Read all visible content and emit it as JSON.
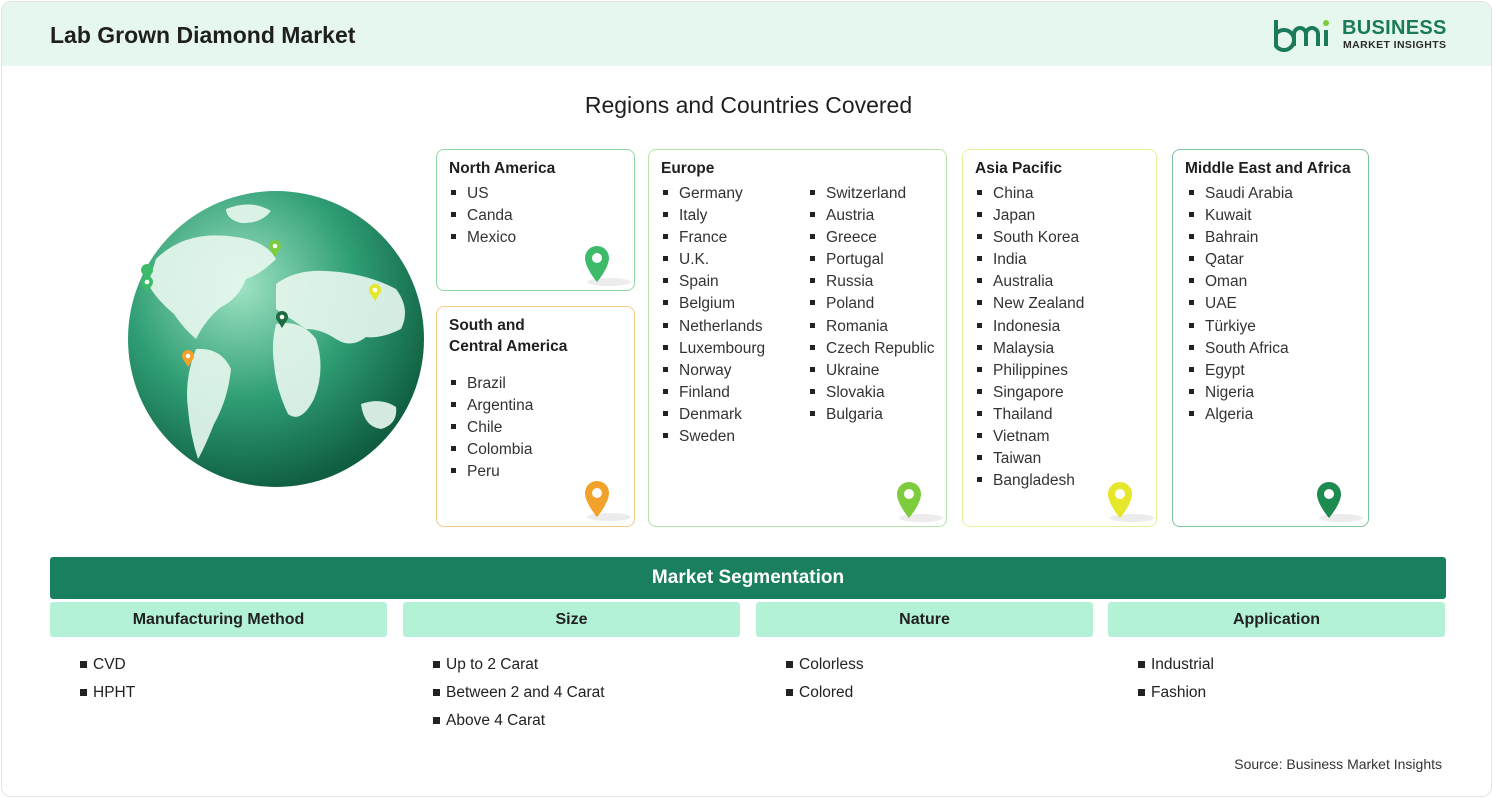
{
  "header": {
    "title": "Lab Grown Diamond Market"
  },
  "logo": {
    "line1": "BUSINESS",
    "line2": "MARKET INSIGHTS",
    "brand_color": "#1a7a5a"
  },
  "subtitle": "Regions and Countries Covered",
  "regions": {
    "north_america": {
      "title": "North America",
      "countries": [
        "US",
        "Canda",
        "Mexico"
      ],
      "pin_color": "#3dbb6a"
    },
    "south_central_america": {
      "title_line1": "South and",
      "title_line2": "Central America",
      "countries": [
        "Brazil",
        "Argentina",
        "Chile",
        "Colombia",
        "Peru"
      ],
      "pin_color": "#f2a12a"
    },
    "europe": {
      "title": "Europe",
      "countries_col1": [
        "Germany",
        "Italy",
        "France",
        "U.K.",
        "Spain",
        "Belgium",
        "Netherlands",
        "Luxembourg",
        "Norway",
        "Finland",
        "Denmark",
        "Sweden"
      ],
      "countries_col2": [
        "Switzerland",
        "Austria",
        "Greece",
        "Portugal",
        "Russia",
        "Poland",
        "Romania",
        "Czech Republic",
        "Ukraine",
        "Slovakia",
        "Bulgaria"
      ],
      "pin_color": "#7dcc3e"
    },
    "asia_pacific": {
      "title": "Asia Pacific",
      "countries": [
        "China",
        "Japan",
        "South Korea",
        "India",
        "Australia",
        "New Zealand",
        "Indonesia",
        "Malaysia",
        "Philippines",
        "Singapore",
        "Thailand",
        "Vietnam",
        "Taiwan",
        "Bangladesh"
      ],
      "pin_color": "#e6e62a"
    },
    "middle_east_africa": {
      "title": "Middle East and Africa",
      "countries": [
        "Saudi Arabia",
        "Kuwait",
        "Bahrain",
        "Qatar",
        "Oman",
        "UAE",
        "Türkiye",
        "South Africa",
        "Egypt",
        "Nigeria",
        "Algeria"
      ],
      "pin_color": "#1d8a4f"
    }
  },
  "segmentation": {
    "title": "Market Segmentation",
    "columns": [
      {
        "header": "Manufacturing Method",
        "items": [
          "CVD",
          "HPHT"
        ]
      },
      {
        "header": "Size",
        "items": [
          "Up to 2 Carat",
          "Between 2 and 4 Carat",
          "Above 4 Carat"
        ]
      },
      {
        "header": "Nature",
        "items": [
          "Colorless",
          "Colored"
        ]
      },
      {
        "header": "Application",
        "items": [
          "Industrial",
          "Fashion"
        ]
      }
    ]
  },
  "source": "Source: Business Market Insights"
}
